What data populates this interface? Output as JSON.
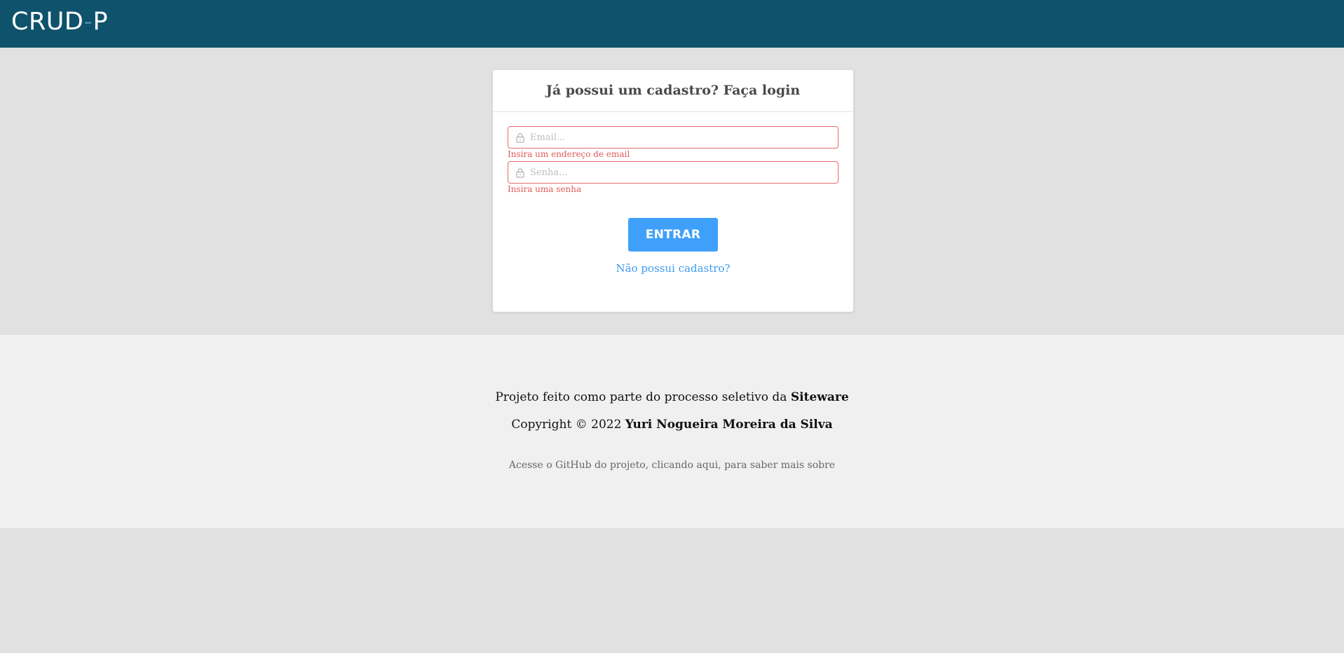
{
  "navbar": {
    "logo_left": "CRUD",
    "logo_dash": "-",
    "logo_right": "P",
    "background": "#0e526b"
  },
  "login": {
    "title": "Já possui um cadastro? Faça login",
    "email_placeholder": "Email...",
    "email_error": "Insira um endereço de email",
    "password_placeholder": "Senha...",
    "password_error": "Insira uma senha",
    "submit_label": "ENTRAR",
    "register_link": "Não possui cadastro?",
    "field_icon": "lock-icon",
    "error_color": "#e25a5a",
    "button_color": "#3fa0fb"
  },
  "footer": {
    "line1_prefix": "Projeto feito como parte do processo seletivo da ",
    "line1_company": "Siteware",
    "line2_prefix": "Copyright © 2022 ",
    "line2_author": "Yuri Nogueira Moreira da Silva",
    "line3": "Acesse o GitHub do projeto, clicando aqui, para saber mais sobre"
  }
}
